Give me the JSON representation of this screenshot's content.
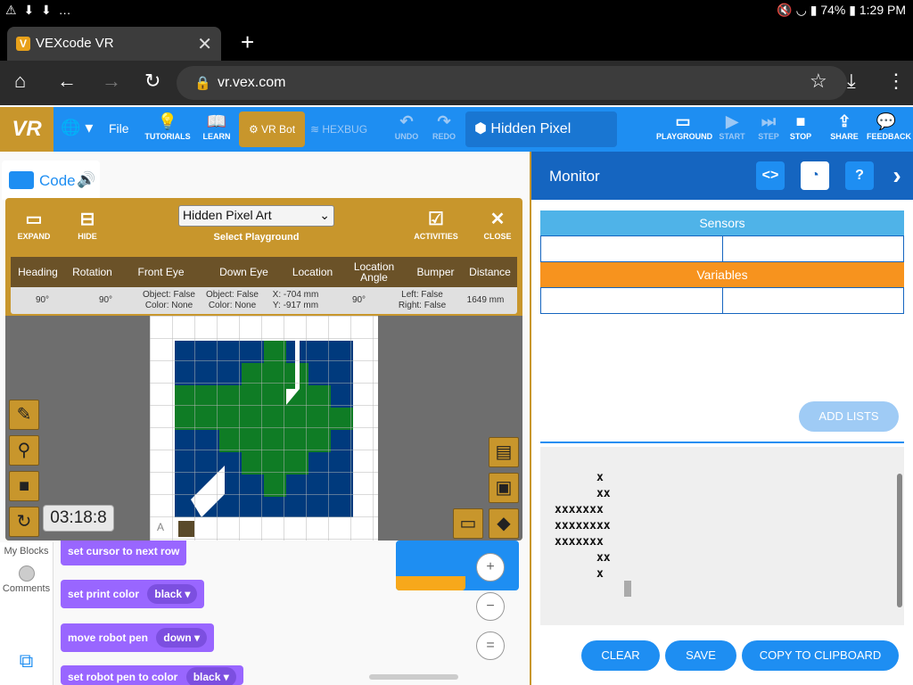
{
  "status_bar": {
    "left_icons": "⚠ ⬇ ⬇ …",
    "right_text": "74%",
    "time": "1:29 PM"
  },
  "browser": {
    "tab_title": "VEXcode VR",
    "url": "vr.vex.com"
  },
  "header": {
    "logo": "VR",
    "file": "File",
    "tutorials": "TUTORIALS",
    "learn": "LEARN",
    "vr_bot": "VR Bot",
    "hexbug": "HEXBUG",
    "undo": "UNDO",
    "redo": "REDO",
    "project_name": "Hidden Pixel",
    "playground": "PLAYGROUND",
    "start": "START",
    "step": "STEP",
    "stop": "STOP",
    "share": "SHARE",
    "feedback": "FEEDBACK"
  },
  "workspace": {
    "code_tab": "Code",
    "categories": {
      "my_blocks": "My Blocks",
      "comments": "Comments"
    },
    "blocks": {
      "set_cursor": "set cursor to next row",
      "set_print_color": "set print color",
      "print_color_value": "black",
      "move_pen": "move robot pen",
      "move_pen_value": "down",
      "set_pen_color": "set robot pen to color",
      "pen_color_value": "black"
    },
    "zoom": {
      "in": "+",
      "out": "−",
      "reset": "="
    }
  },
  "playground_window": {
    "expand": "EXPAND",
    "hide": "HIDE",
    "select_value": "Hidden Pixel Art",
    "select_label": "Select Playground",
    "activities": "ACTIVITIES",
    "close": "CLOSE",
    "sensor_headers": [
      "Heading",
      "Rotation",
      "Front Eye",
      "Down Eye",
      "Location",
      "Location Angle",
      "Bumper",
      "Distance"
    ],
    "sensor_values": [
      "90°",
      "90°",
      "Object: False\nColor: None",
      "Object: False\nColor: None",
      "X: -704 mm\nY: -917 mm",
      "90°",
      "Left: False\nRight: False",
      "1649 mm"
    ],
    "timer": "03:18:8",
    "corner_label": "A"
  },
  "monitor": {
    "title": "Monitor",
    "sensors": "Sensors",
    "variables": "Variables",
    "add_lists": "ADD LISTS",
    "console_lines": "      x\n      xx\nxxxxxxx\nxxxxxxxx\nxxxxxxx\n      xx\n      x",
    "clear": "CLEAR",
    "save": "SAVE",
    "copy": "COPY TO CLIPBOARD"
  },
  "colors": {
    "vex_blue": "#1e8ef2",
    "gold": "#c8962c",
    "monitor_blue": "#1565c0",
    "sensors_blue": "#4fb3e8",
    "variables_orange": "#f7931e",
    "pixel_navy": "#003a7d",
    "pixel_green": "#0f7c25",
    "block_purple": "#9966ff"
  }
}
